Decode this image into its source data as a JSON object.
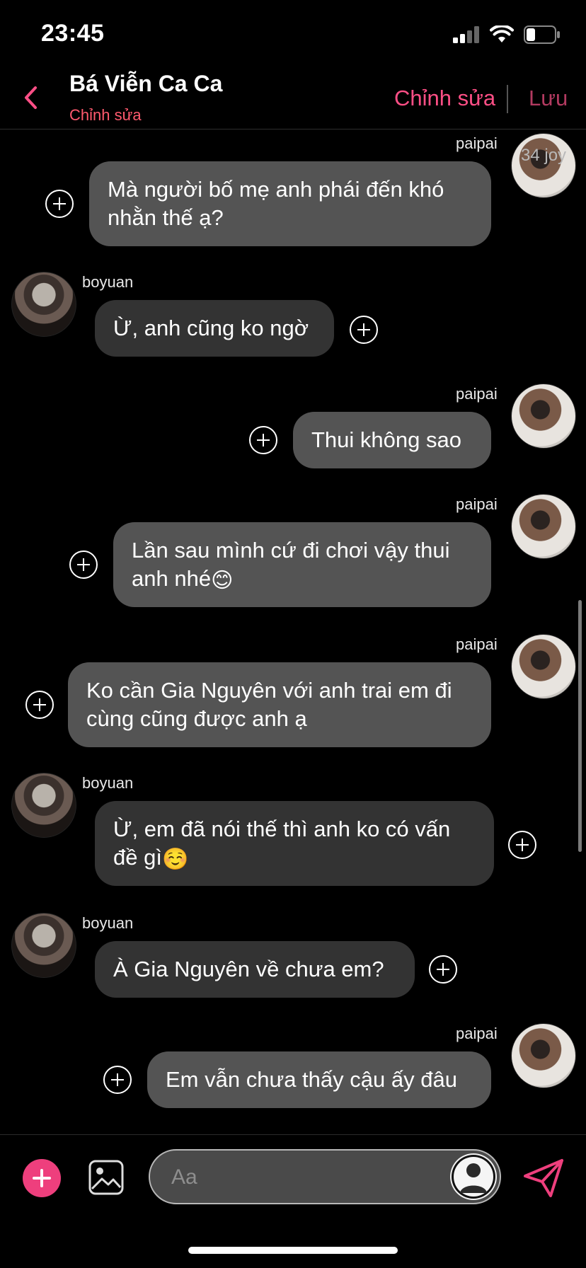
{
  "status": {
    "time": "23:45"
  },
  "header": {
    "title": "Bá Viễn Ca Ca",
    "subtitle": "Chỉnh sửa",
    "edit_label": "Chỉnh sửa",
    "save_label": "Lưu"
  },
  "overlay_text": "34 joy",
  "messages": [
    {
      "sender": "paipai",
      "side": "right",
      "lines": [
        "Mà người bố mẹ anh phái đến khó",
        "nhằn thế ạ?"
      ]
    },
    {
      "sender": "boyuan",
      "side": "left",
      "lines": [
        "Ừ, anh cũng ko ngờ"
      ]
    },
    {
      "sender": "paipai",
      "side": "right",
      "lines": [
        "Thui không sao"
      ]
    },
    {
      "sender": "paipai",
      "side": "right",
      "lines": [
        "Lần sau mình cứ đi chơi vậy thui",
        "anh nhé"
      ],
      "emoji": "😊"
    },
    {
      "sender": "paipai",
      "side": "right",
      "lines": [
        "Ko cần Gia Nguyên với anh trai em đi",
        "cùng cũng được anh ạ"
      ]
    },
    {
      "sender": "boyuan",
      "side": "left",
      "lines": [
        "Ừ, em đã nói thế thì anh ko có vấn",
        "đề gì"
      ],
      "emoji": "☺️"
    },
    {
      "sender": "boyuan",
      "side": "left",
      "lines": [
        "À Gia Nguyên về chưa em?"
      ]
    },
    {
      "sender": "paipai",
      "side": "right",
      "lines": [
        "Em vẫn chưa thấy cậu ấy đâu"
      ]
    }
  ],
  "composer": {
    "placeholder": "Aa"
  },
  "colors": {
    "accent": "#ee3f7d",
    "bubble_me": "#545454",
    "bubble_them": "#333333"
  },
  "icons": [
    "back-chevron-icon",
    "signal-icon",
    "wifi-icon",
    "battery-icon",
    "plus-circle-icon",
    "image-icon",
    "send-icon",
    "profile-icon"
  ]
}
